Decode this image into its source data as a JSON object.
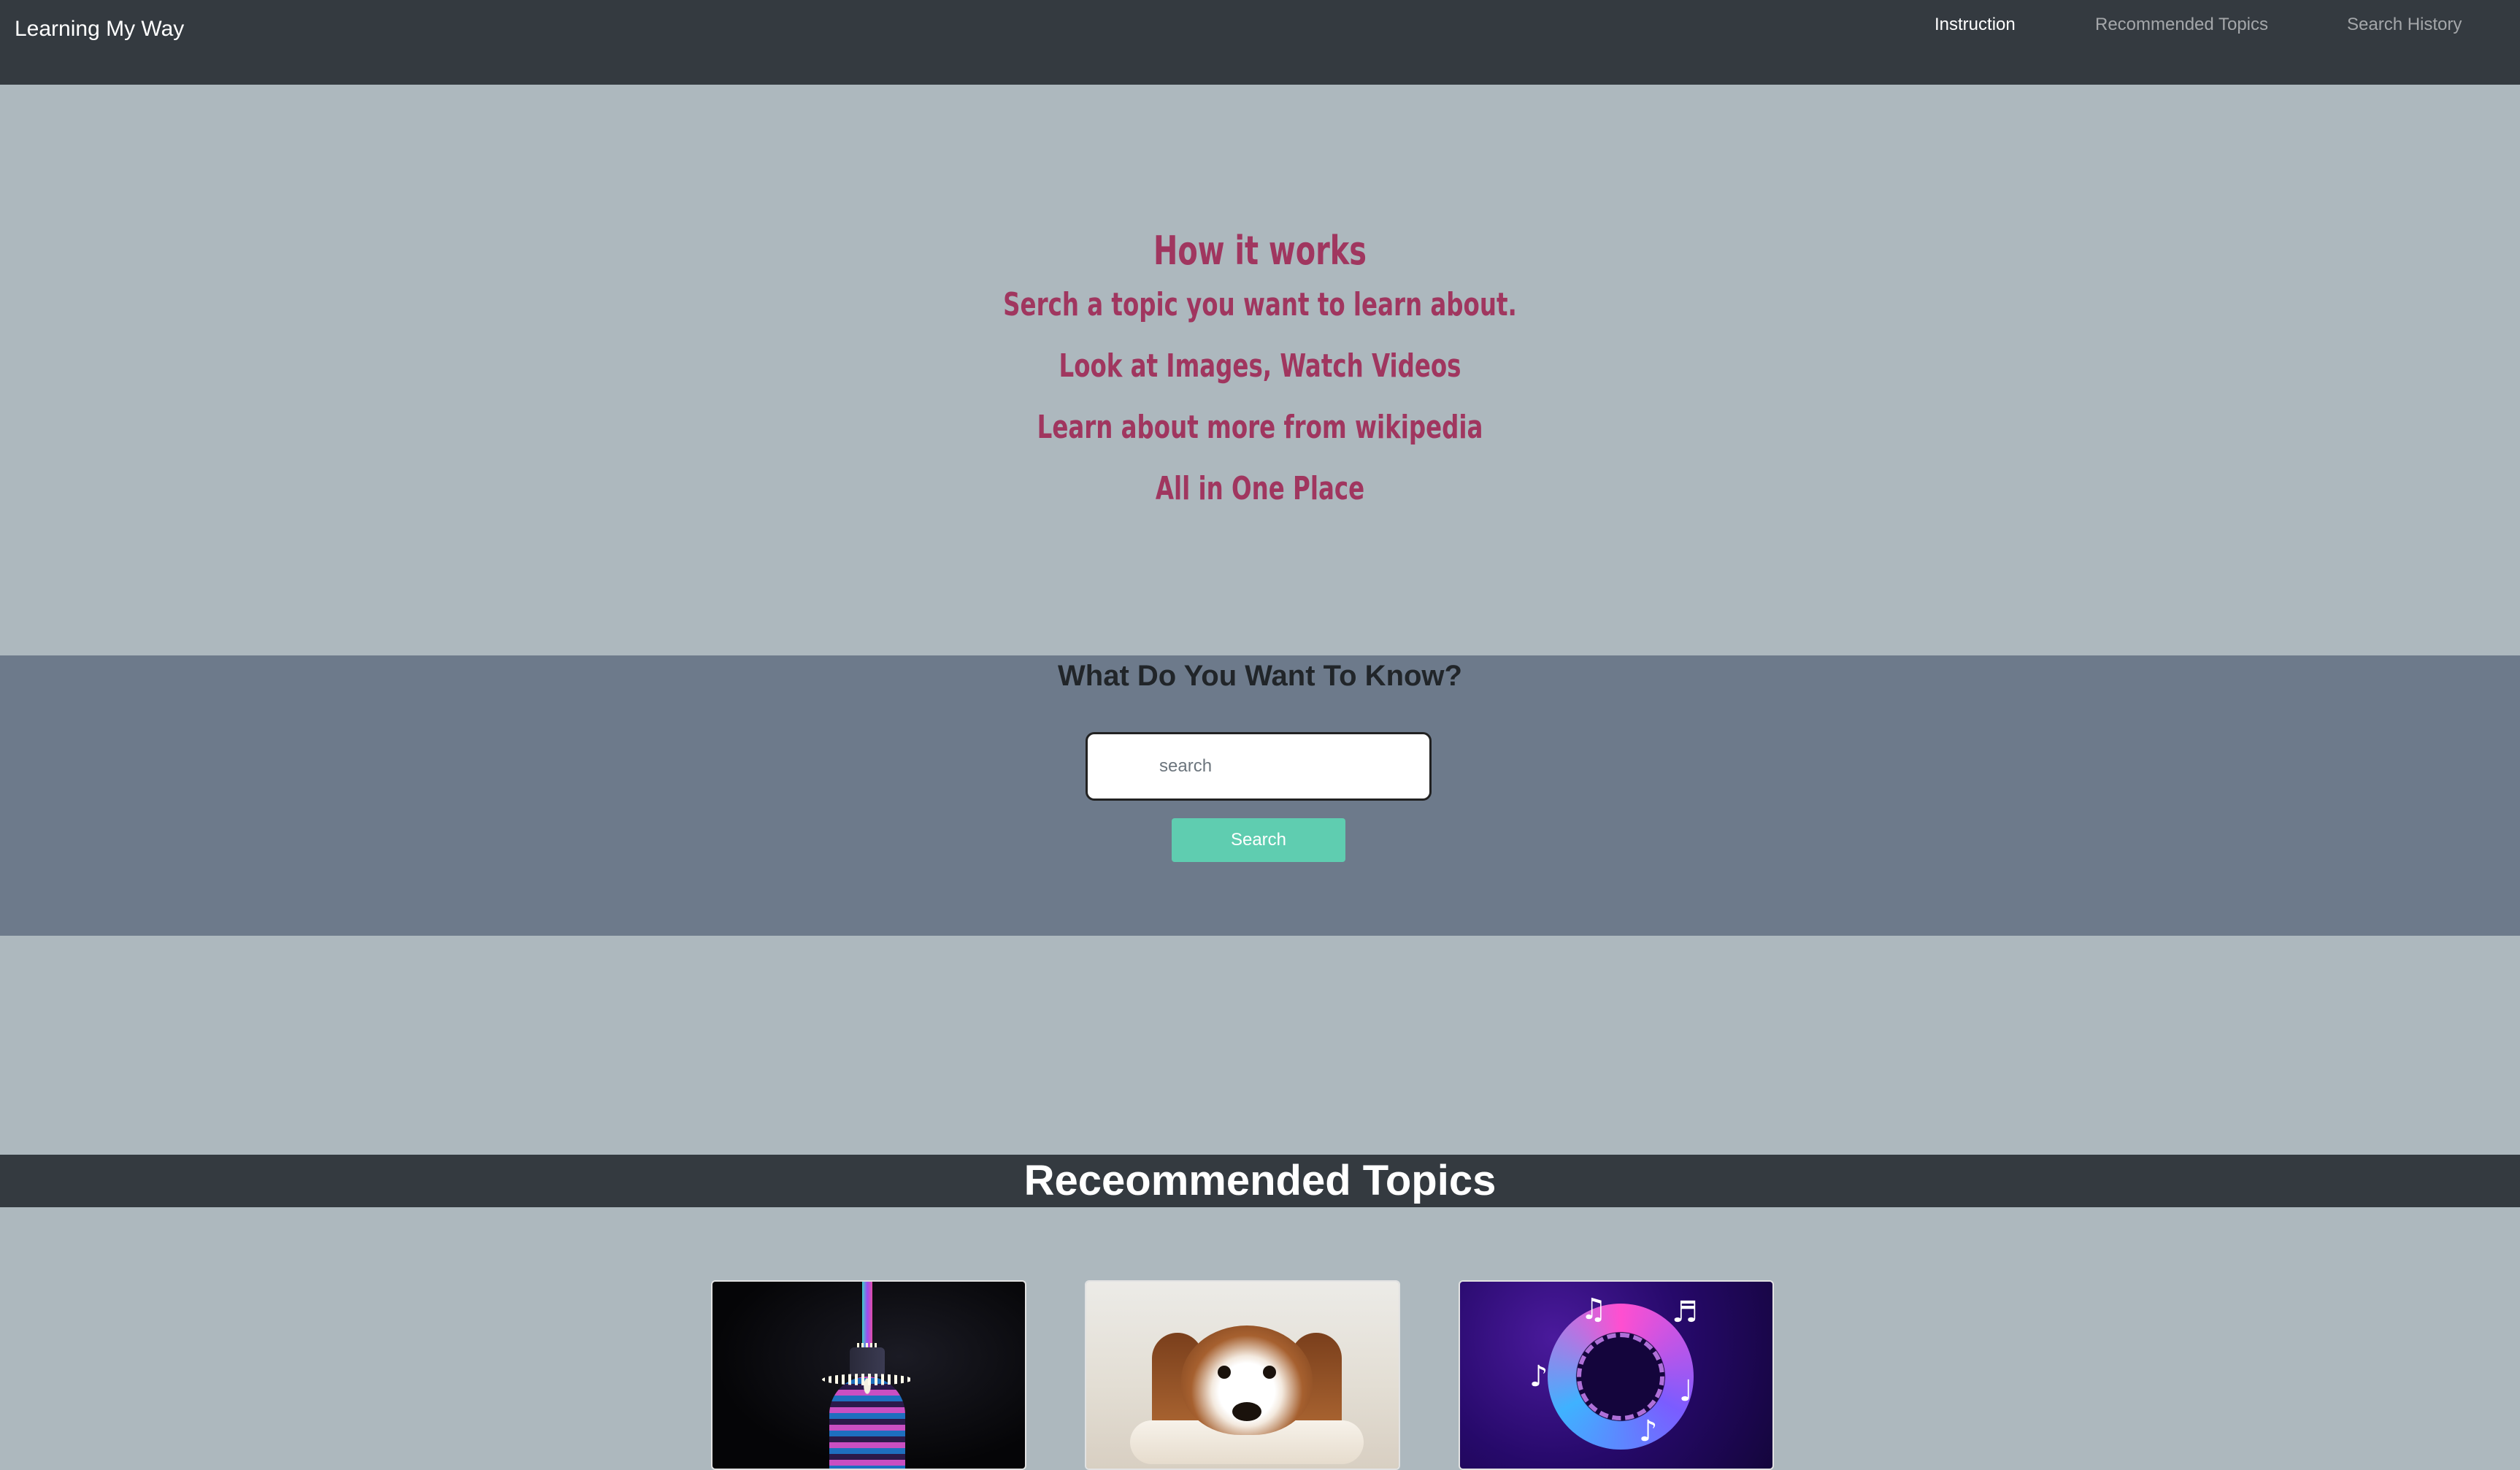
{
  "navbar": {
    "brand": "Learning My Way",
    "links": [
      {
        "label": "Instruction",
        "active": true
      },
      {
        "label": "Recommended Topics",
        "active": false
      },
      {
        "label": "Search History",
        "active": false
      }
    ]
  },
  "how_it_works": {
    "title": "How it works",
    "lines": [
      "Serch a topic you want to learn about.",
      "Look at Images, Watch Videos",
      "Learn about more from wikipedia",
      "All in One Place"
    ]
  },
  "search": {
    "heading": "What Do You Want To Know?",
    "placeholder": "search",
    "value": "",
    "button_label": "Search"
  },
  "recommended": {
    "title": "Receommended Topics",
    "cards": [
      {
        "image": "illuminated-tower-at-night"
      },
      {
        "image": "puppy-lying-on-floor"
      },
      {
        "image": "music-notes-neon-circle"
      }
    ]
  },
  "colors": {
    "navbar_bg": "#343a40",
    "page_bg": "#adb8be",
    "search_band_bg": "#6d7a8b",
    "accent_text": "#a0365f",
    "button_bg": "#5fcdb0"
  }
}
